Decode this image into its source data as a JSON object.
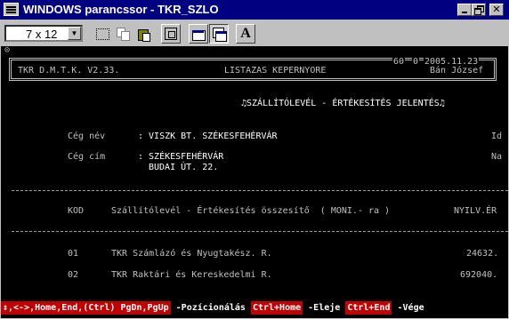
{
  "window": {
    "title": "WINDOWS parancssor - TKR_SZLO"
  },
  "toolbar": {
    "font_size": "7 x 12",
    "tools": [
      "mark-icon",
      "copy-icon",
      "paste-icon",
      "fullscreen-icon",
      "properties-icon",
      "background-icon",
      "font-icon"
    ],
    "font_button_label": "A"
  },
  "screen": {
    "top_glyph": "⊙",
    "app_title": "TKR D.M.T.K. V2.33.",
    "screen_title": "LISTAZAS KEPERNYORE",
    "page_no": "60",
    "sub_no": "0",
    "date": "2005.11.23",
    "user": "Bán József",
    "report_title": "♫SZÁLLÍTÓLEVÉL - ÉRTÉKESÍTÉS JELENTÉS♫",
    "company_label": "Cég név",
    "company_name": ": VISZK BT. SZÉKESFEHÉRVÁR",
    "company_right_tag": "Id",
    "address_label": "Cég cím",
    "address_line1": ": SZÉKESFEHÉRVÁR",
    "address_line2": "BUDAI ÚT. 22.",
    "address_right_tag": "Na",
    "col_kod": "KOD",
    "col_desc": "Szállítólevél - Értékesítés összesítő  ( MONI.- ra )",
    "col_right": "NYILV.ÉR",
    "rows": [
      {
        "code": "01",
        "name": "TKR Számlázó és Nyugtakész. R.",
        "value": "24632."
      },
      {
        "code": "02",
        "name": "TKR Raktári és Kereskedelmi R.",
        "value": "692040."
      }
    ]
  },
  "statusbar": {
    "items": [
      {
        "key": "↕,<->,Home,End,(Ctrl) PgDn,PgUp",
        "label": " -Pozícionálás "
      },
      {
        "key": "Ctrl+Home",
        "label": " -Eleje "
      },
      {
        "key": "Ctrl+End",
        "label": " -Vége"
      }
    ]
  },
  "colors": {
    "titlebar": "#000080",
    "console_bg": "#000000",
    "console_text": "#c0c0c0",
    "key_highlight": "#c00000"
  }
}
